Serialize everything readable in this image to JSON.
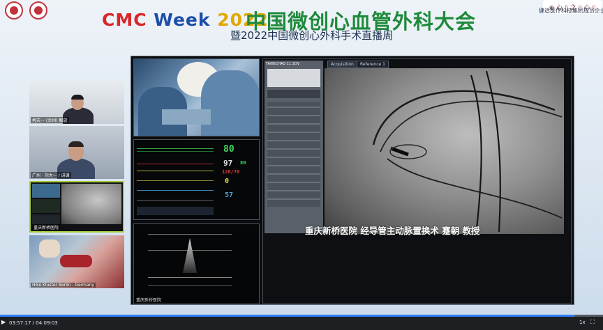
{
  "header": {
    "title_en_1": "CMC ",
    "title_en_2": "Week ",
    "title_en_3": "2022",
    "title_cn": "中国微创心血管外科大会",
    "subtitle": "暨2022中国微创心外科手术直播周",
    "brand_badge": "⊕ 心 ▯ 之 ▯ 心 ▯",
    "brand_text": "健适医疗科技集团成员企业"
  },
  "participants": [
    {
      "caption": "柯天一 (兰州) 解放"
    },
    {
      "caption": "广州 · 刘大一 / 讲课"
    },
    {
      "caption": "重庆新桥医院"
    },
    {
      "caption": "Hiko Kluster Berlin - Germany"
    }
  ],
  "monitor": {
    "hr": "80",
    "spo2": "97",
    "bp": "120/70",
    "val4": "0",
    "val5": "57",
    "val6": "80"
  },
  "fluoro": {
    "tab1": "Acquisition",
    "tab2": "Reference 1",
    "panel_label": "TANGCHAO 11   2DV",
    "caption": "重庆新桥医院  经导管主动脉置换术  蹇朝  教授"
  },
  "echo": {
    "label": "重庆新桥医院"
  },
  "player": {
    "time": "03:57:17 / 04:09:03",
    "speed": "1x",
    "progress": 0.952
  }
}
